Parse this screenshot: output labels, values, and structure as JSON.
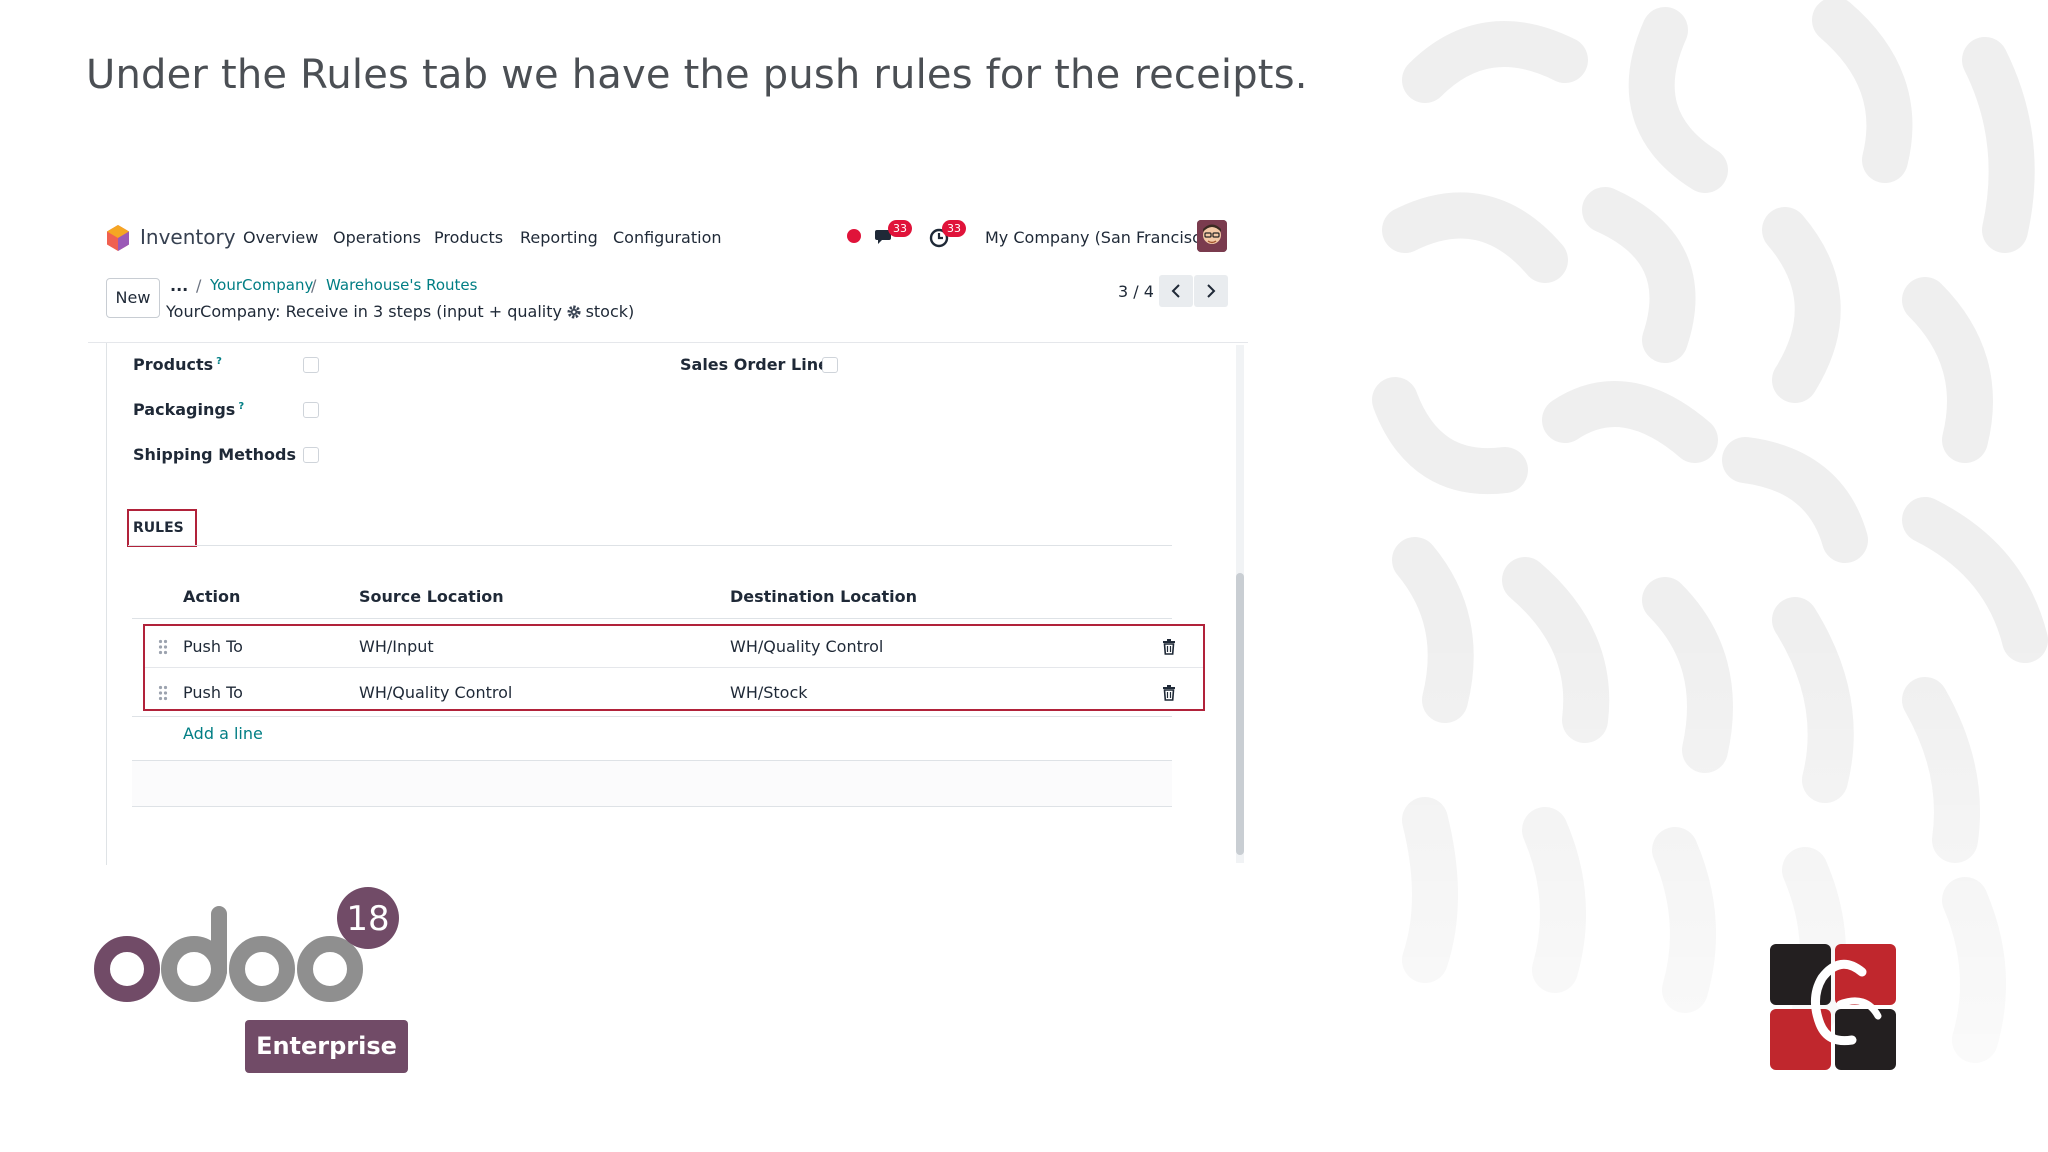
{
  "caption": "Under the Rules tab we have the push rules for the receipts.",
  "navbar": {
    "app_name": "Inventory",
    "menu": [
      "Overview",
      "Operations",
      "Products",
      "Reporting",
      "Configuration"
    ],
    "messages_badge": "33",
    "activities_badge": "33",
    "company": "My Company (San Francisco)"
  },
  "control_panel": {
    "new_label": "New",
    "breadcrumb_ellipsis": "...",
    "breadcrumb": [
      "YourCompany",
      "Warehouse's Routes"
    ],
    "record_title": "YourCompany: Receive in 3 steps (input + quality + stock)",
    "pager": "3 / 4"
  },
  "form": {
    "fields_left": [
      {
        "label": "Products",
        "help": "?",
        "checked": false
      },
      {
        "label": "Packagings",
        "help": "?",
        "checked": false
      },
      {
        "label": "Shipping Methods",
        "help": "",
        "checked": false
      }
    ],
    "fields_right": [
      {
        "label": "Sales Order Lines",
        "checked": false
      }
    ],
    "tab_label": "RULES",
    "table": {
      "headers": [
        "Action",
        "Source Location",
        "Destination Location"
      ],
      "rows": [
        {
          "action": "Push To",
          "source": "WH/Input",
          "destination": "WH/Quality Control"
        },
        {
          "action": "Push To",
          "source": "WH/Quality Control",
          "destination": "WH/Stock"
        }
      ],
      "add_line": "Add a line"
    }
  },
  "branding": {
    "version": "18",
    "edition": "Enterprise"
  },
  "colors": {
    "accent_teal": "#017e84",
    "highlight_red": "#b1223a",
    "odoo_purple": "#714b67",
    "badge_red": "#e0133a"
  }
}
